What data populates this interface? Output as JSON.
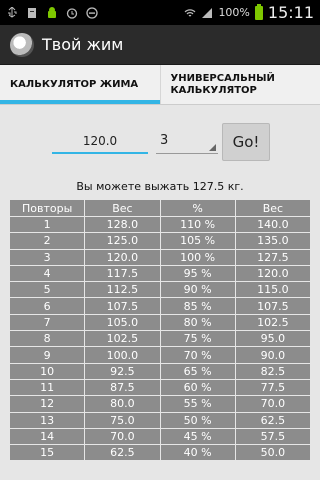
{
  "status_bar": {
    "battery_pct": "100%",
    "time": "15:11"
  },
  "app": {
    "title": "Твой жим"
  },
  "tabs": [
    {
      "label": "КАЛЬКУЛЯТОР ЖИМА",
      "active": true
    },
    {
      "label": "УНИВЕРСАЛЬНЫЙ КАЛЬКУЛЯТОР",
      "active": false
    }
  ],
  "form": {
    "weight_value": "120.0",
    "reps_value": "3",
    "go_label": "Go!"
  },
  "result_text": "Вы можете выжать 127.5 кг.",
  "table": {
    "headers": [
      "Повторы",
      "Вес",
      "%",
      "Вес"
    ],
    "rows": [
      [
        "1",
        "128.0",
        "110 %",
        "140.0"
      ],
      [
        "2",
        "125.0",
        "105 %",
        "135.0"
      ],
      [
        "3",
        "120.0",
        "100 %",
        "127.5"
      ],
      [
        "4",
        "117.5",
        "95 %",
        "120.0"
      ],
      [
        "5",
        "112.5",
        "90 %",
        "115.0"
      ],
      [
        "6",
        "107.5",
        "85 %",
        "107.5"
      ],
      [
        "7",
        "105.0",
        "80 %",
        "102.5"
      ],
      [
        "8",
        "102.5",
        "75 %",
        "95.0"
      ],
      [
        "9",
        "100.0",
        "70 %",
        "90.0"
      ],
      [
        "10",
        "92.5",
        "65 %",
        "82.5"
      ],
      [
        "11",
        "87.5",
        "60 %",
        "77.5"
      ],
      [
        "12",
        "80.0",
        "55 %",
        "70.0"
      ],
      [
        "13",
        "75.0",
        "50 %",
        "62.5"
      ],
      [
        "14",
        "70.0",
        "45 %",
        "57.5"
      ],
      [
        "15",
        "62.5",
        "40 %",
        "50.0"
      ]
    ]
  },
  "colors": {
    "accent": "#33b5e5",
    "action_bar": "#2b2b2b",
    "table_cell": "#8c8c8c",
    "content_bg": "#e6e6e6"
  }
}
